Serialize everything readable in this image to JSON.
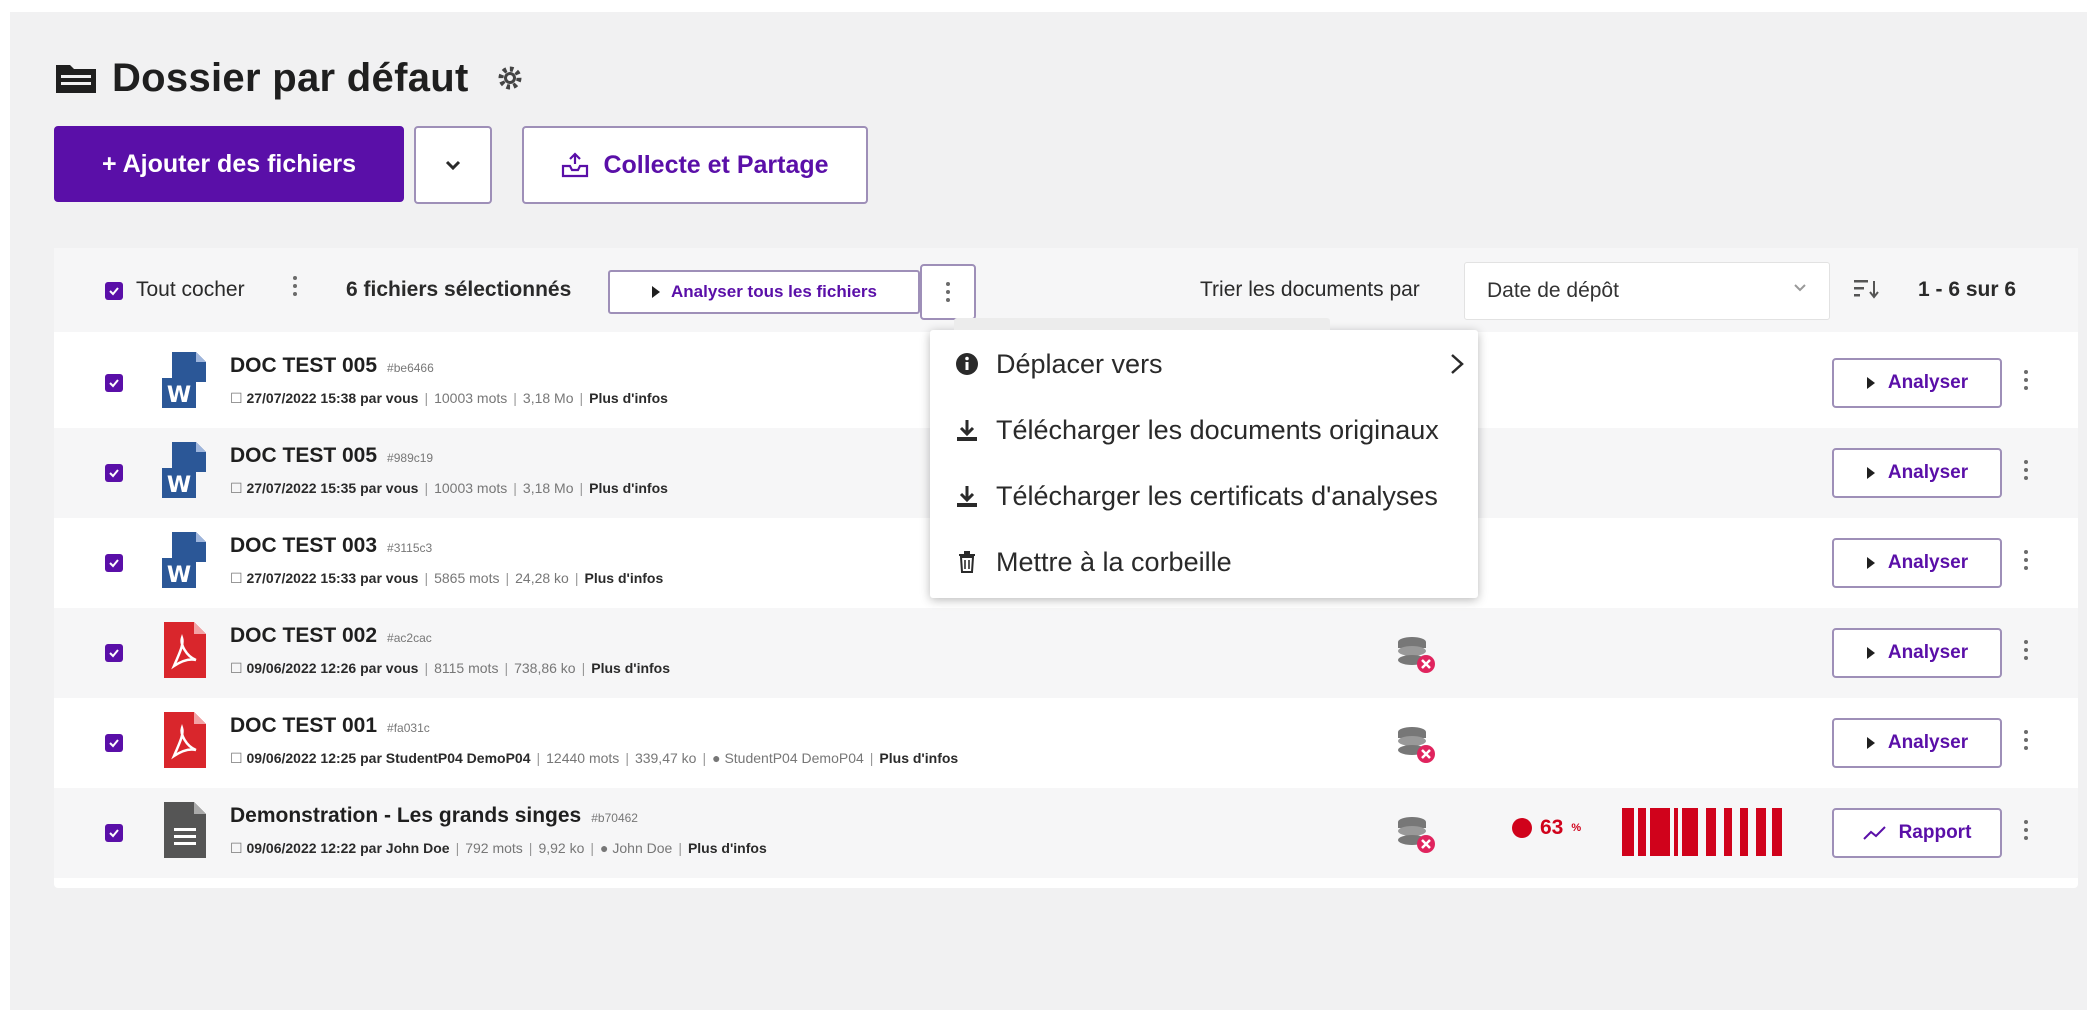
{
  "header": {
    "title": "Dossier par défaut",
    "add_files_label": "+ Ajouter des fichiers",
    "collect_share_label": "Collecte et Partage"
  },
  "toolbar": {
    "check_all_label": "Tout cocher",
    "selected_count_label": "6 fichiers sélectionnés",
    "analyze_all_label": "Analyser tous les fichiers",
    "sort_label": "Trier les documents par",
    "sort_value": "Date de dépôt",
    "pagination": "1 - 6 sur 6"
  },
  "context_menu": {
    "items": [
      {
        "label": "Déplacer vers",
        "icon": "info-icon"
      },
      {
        "label": "Télécharger les documents originaux",
        "icon": "download-icon"
      },
      {
        "label": "Télécharger les certificats d'analyses",
        "icon": "download-icon"
      },
      {
        "label": "Mettre à la corbeille",
        "icon": "trash-icon"
      }
    ]
  },
  "files": [
    {
      "name": "DOC TEST 005",
      "hash": "#be6466",
      "date": "27/07/2022 15:38 par vous",
      "words": "10003 mots",
      "size": "3,18 Mo",
      "more": "Plus d'infos",
      "type": "word",
      "action": "Analyser"
    },
    {
      "name": "DOC TEST 005",
      "hash": "#989c19",
      "date": "27/07/2022 15:35 par vous",
      "words": "10003 mots",
      "size": "3,18 Mo",
      "more": "Plus d'infos",
      "type": "word",
      "action": "Analyser"
    },
    {
      "name": "DOC TEST 003",
      "hash": "#3115c3",
      "date": "27/07/2022 15:33 par vous",
      "words": "5865 mots",
      "size": "24,28 ko",
      "more": "Plus d'infos",
      "type": "word",
      "action": "Analyser"
    },
    {
      "name": "DOC TEST 002",
      "hash": "#ac2cac",
      "date": "09/06/2022 12:26 par vous",
      "words": "8115 mots",
      "size": "738,86 ko",
      "more": "Plus d'infos",
      "type": "pdf",
      "action": "Analyser"
    },
    {
      "name": "DOC TEST 001",
      "hash": "#fa031c",
      "date": "09/06/2022 12:25 par StudentP04 DemoP04",
      "words": "12440 mots",
      "size": "339,47 ko",
      "owner": "StudentP04 DemoP04",
      "more": "Plus d'infos",
      "type": "pdf",
      "action": "Analyser"
    },
    {
      "name": "Demonstration - Les grands singes",
      "hash": "#b70462",
      "date": "09/06/2022 12:22 par John Doe",
      "words": "792 mots",
      "size": "9,92 ko",
      "owner": "John Doe",
      "more": "Plus d'infos",
      "type": "doc",
      "score": "63",
      "score_unit": "%",
      "action": "Rapport"
    }
  ],
  "colors": {
    "accent": "#5a0fa8",
    "danger": "#d0021b",
    "word": "#2b5797",
    "pdf": "#d9262c"
  }
}
